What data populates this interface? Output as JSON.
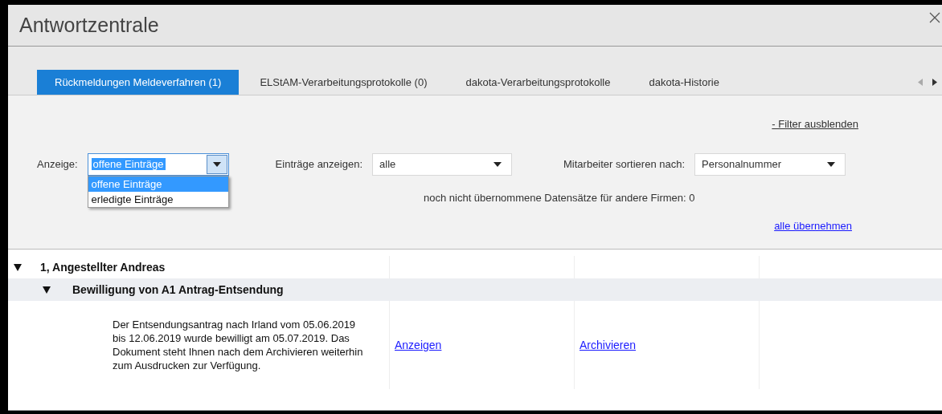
{
  "window": {
    "title": "Antwortzentrale"
  },
  "tabs": [
    {
      "label": "Rückmeldungen Meldeverfahren (1)",
      "selected": true
    },
    {
      "label": "ELStAM-Verarbeitungsprotokolle (0)",
      "selected": false
    },
    {
      "label": "dakota-Verarbeitungsprotokolle",
      "selected": false
    },
    {
      "label": "dakota-Historie",
      "selected": false
    }
  ],
  "filter_toggle": "- Filter ausblenden",
  "anzeige": {
    "label": "Anzeige:",
    "value": "offene Einträge",
    "expanded": true,
    "options": [
      {
        "label": "offene Einträge",
        "selected": true
      },
      {
        "label": "erledigte Einträge",
        "selected": false
      }
    ]
  },
  "eintraege": {
    "label": "Einträge anzeigen:",
    "value": "alle"
  },
  "sortierung": {
    "label": "Mitarbeiter sortieren nach:",
    "value": "Personalnummer"
  },
  "info": "noch nicht übernommene Datensätze für andere Firmen: 0",
  "accept_all": "alle übernehmen",
  "tree": [
    {
      "label": "1, Angestellter Andreas",
      "expanded": true,
      "children": [
        {
          "label": "Bewilligung von A1 Antrag-Entsendung",
          "expanded": true,
          "entries": [
            {
              "text": "Der Entsendungsantrag nach Irland vom 05.06.2019 bis 12.06.2019 wurde bewilligt am 05.07.2019. Das Dokument steht Ihnen nach dem Archivieren weiterhin zum Ausdrucken zur Verfügung.",
              "actions": [
                "Anzeigen",
                "Archivieren"
              ]
            }
          ]
        }
      ]
    }
  ]
}
